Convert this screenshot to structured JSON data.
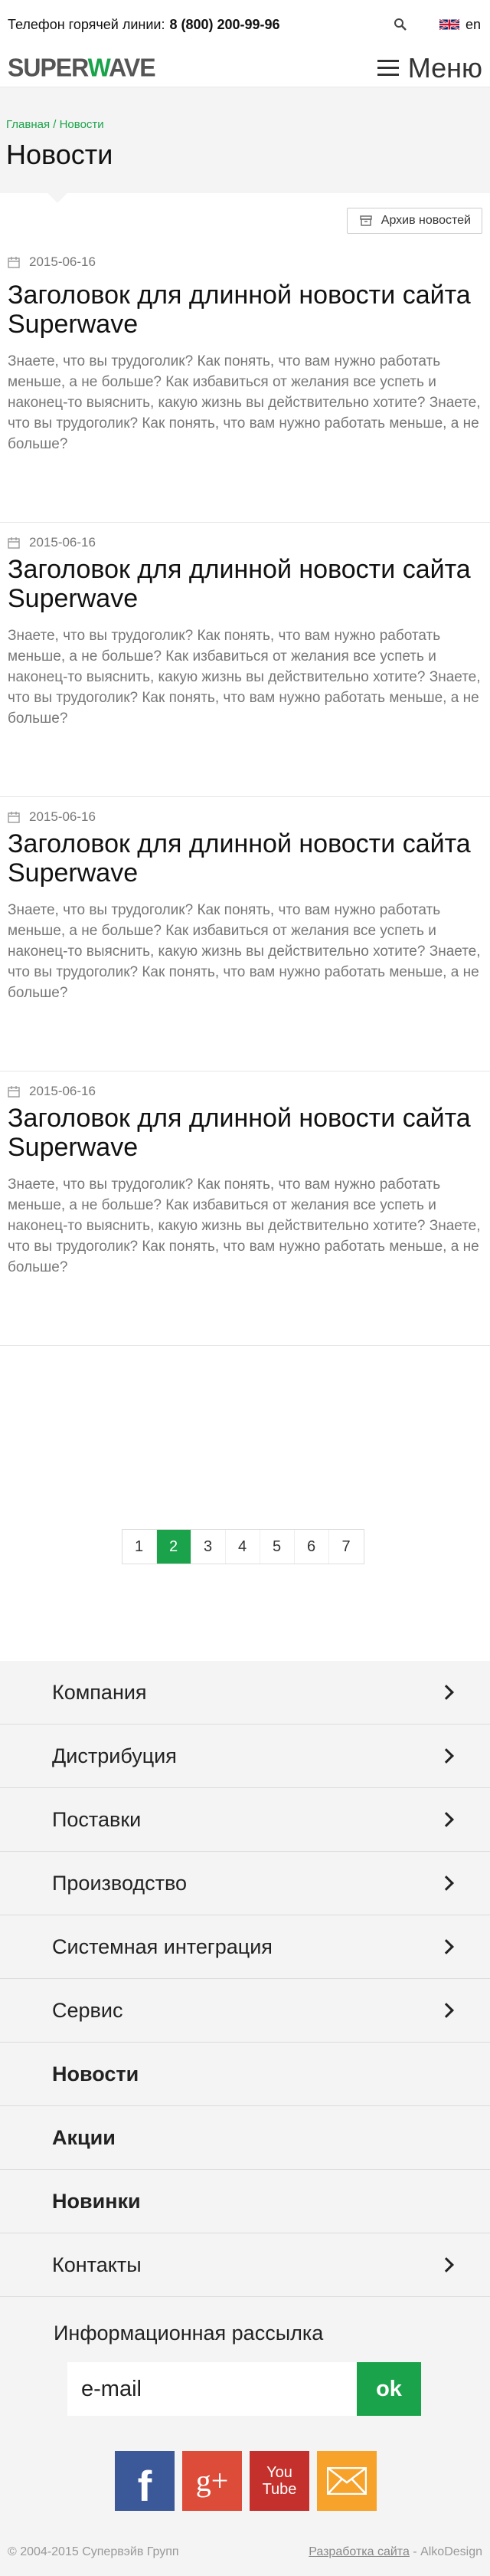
{
  "topbar": {
    "hotline_label": "Телефон горячей линии:",
    "hotline_phone": "8 (800) 200-99-96",
    "search_icon": "search-icon",
    "language": "en"
  },
  "header": {
    "logo_part1": "SUPER",
    "logo_w": "W",
    "logo_part2": "AVE",
    "menu_label": "Меню"
  },
  "page": {
    "breadcrumb": "Главная / Новости",
    "title": "Новости",
    "archive_label": "Архив новостей"
  },
  "news": [
    {
      "date": "2015-06-16",
      "title": "Заголовок для длинной новости сайта Superwave",
      "excerpt": "Знаете, что вы трудоголик? Как понять, что вам нужно работать меньше, а не больше? Как избавиться от желания все успеть и наконец-то выяснить, какую жизнь вы действительно хотите? Знаете, что вы трудоголик? Как понять, что вам нужно работать меньше, а не больше?"
    },
    {
      "date": "2015-06-16",
      "title": "Заголовок для длинной новости сайта Superwave",
      "excerpt": "Знаете, что вы трудоголик? Как понять, что вам нужно работать меньше, а не больше? Как избавиться от желания все успеть и наконец-то выяснить, какую жизнь вы действительно хотите? Знаете, что вы трудоголик? Как понять, что вам нужно работать меньше, а не больше?"
    },
    {
      "date": "2015-06-16",
      "title": "Заголовок для длинной новости сайта Superwave",
      "excerpt": "Знаете, что вы трудоголик? Как понять, что вам нужно работать меньше, а не больше? Как избавиться от желания все успеть и наконец-то выяснить, какую жизнь вы действительно хотите? Знаете, что вы трудоголик? Как понять, что вам нужно работать меньше, а не больше?"
    },
    {
      "date": "2015-06-16",
      "title": "Заголовок для длинной новости сайта Superwave",
      "excerpt": "Знаете, что вы трудоголик? Как понять, что вам нужно работать меньше, а не больше? Как избавиться от желания все успеть и наконец-то выяснить, какую жизнь вы действительно хотите? Знаете, что вы трудоголик? Как понять, что вам нужно работать меньше, а не больше?"
    }
  ],
  "pagination": {
    "pages": [
      "1",
      "2",
      "3",
      "4",
      "5",
      "6",
      "7"
    ],
    "active": "2"
  },
  "footer_menu": [
    {
      "label": "Компания",
      "arrow": true,
      "bold": false
    },
    {
      "label": "Дистрибуция",
      "arrow": true,
      "bold": false
    },
    {
      "label": "Поставки",
      "arrow": true,
      "bold": false
    },
    {
      "label": "Производство",
      "arrow": true,
      "bold": false
    },
    {
      "label": "Системная интеграция",
      "arrow": true,
      "bold": false
    },
    {
      "label": "Сервис",
      "arrow": true,
      "bold": false
    },
    {
      "label": "Новости",
      "arrow": false,
      "bold": true
    },
    {
      "label": "Акции",
      "arrow": false,
      "bold": true
    },
    {
      "label": "Новинки",
      "arrow": false,
      "bold": true
    },
    {
      "label": "Контакты",
      "arrow": true,
      "bold": false
    }
  ],
  "newsletter": {
    "title": "Информационная рассылка",
    "placeholder": "e-mail",
    "button": "ok"
  },
  "social": [
    {
      "name": "facebook-icon",
      "glyph": "f",
      "color": "#3b5998"
    },
    {
      "name": "google-plus-icon",
      "glyph": "g+",
      "color": "#dd4b39"
    },
    {
      "name": "youtube-icon",
      "glyph": "You Tube",
      "color": "#c4302b"
    },
    {
      "name": "email-icon",
      "glyph": "",
      "color": "#f7a22b"
    }
  ],
  "copyright": {
    "text": "© 2004-2015 Супервэйв Групп",
    "dev_link": "Разработка сайта",
    "dev_sep": " - ",
    "dev_name": "AlkoDesign"
  },
  "colors": {
    "accent": "#1aa34a",
    "background_gray": "#f4f4f4"
  }
}
